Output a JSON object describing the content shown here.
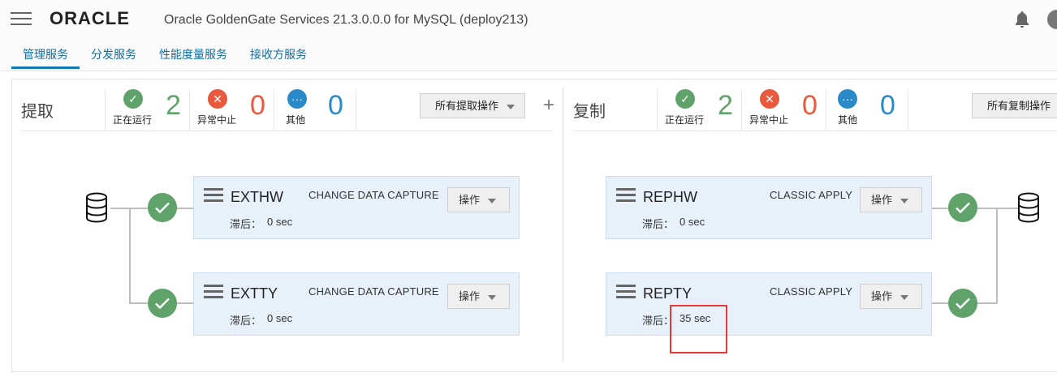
{
  "header": {
    "logo": "ORACLE",
    "title": "Oracle GoldenGate Services 21.3.0.0.0 for MySQL (deploy213)",
    "icons": {
      "menu": "hamburger-icon",
      "notifications": "bell-icon"
    }
  },
  "tabs": [
    {
      "label": "管理服务",
      "active": true
    },
    {
      "label": "分发服务",
      "active": false
    },
    {
      "label": "性能度量服务",
      "active": false
    },
    {
      "label": "接收方服务",
      "active": false
    }
  ],
  "extract": {
    "title": "提取",
    "stats": {
      "running": {
        "label": "正在运行",
        "count": "2",
        "icon": "check-icon"
      },
      "abended": {
        "label": "异常中止",
        "count": "0",
        "icon": "close-icon"
      },
      "other": {
        "label": "其他",
        "count": "0",
        "icon": "more-icon"
      }
    },
    "all_actions_label": "所有提取操作",
    "add_label": "+",
    "processes": [
      {
        "name": "EXTHW",
        "type": "CHANGE DATA CAPTURE",
        "lag_label": "滞后：",
        "lag_value": "0 sec",
        "action_label": "操作",
        "status": "running"
      },
      {
        "name": "EXTTY",
        "type": "CHANGE DATA CAPTURE",
        "lag_label": "滞后：",
        "lag_value": "0 sec",
        "action_label": "操作",
        "status": "running"
      }
    ]
  },
  "replicat": {
    "title": "复制",
    "stats": {
      "running": {
        "label": "正在运行",
        "count": "2",
        "icon": "check-icon"
      },
      "abended": {
        "label": "异常中止",
        "count": "0",
        "icon": "close-icon"
      },
      "other": {
        "label": "其他",
        "count": "0",
        "icon": "more-icon"
      }
    },
    "all_actions_label": "所有复制操作",
    "processes": [
      {
        "name": "REPHW",
        "type": "CLASSIC APPLY",
        "lag_label": "滞后：",
        "lag_value": "0 sec",
        "action_label": "操作",
        "status": "running"
      },
      {
        "name": "REPTY",
        "type": "CLASSIC APPLY",
        "lag_label": "滞后：",
        "lag_value": "35 sec",
        "action_label": "操作",
        "status": "running"
      }
    ]
  },
  "colors": {
    "running": "#5fa36b",
    "abended": "#e9593e",
    "other": "#2a8ac8",
    "highlight": "#e53935"
  }
}
